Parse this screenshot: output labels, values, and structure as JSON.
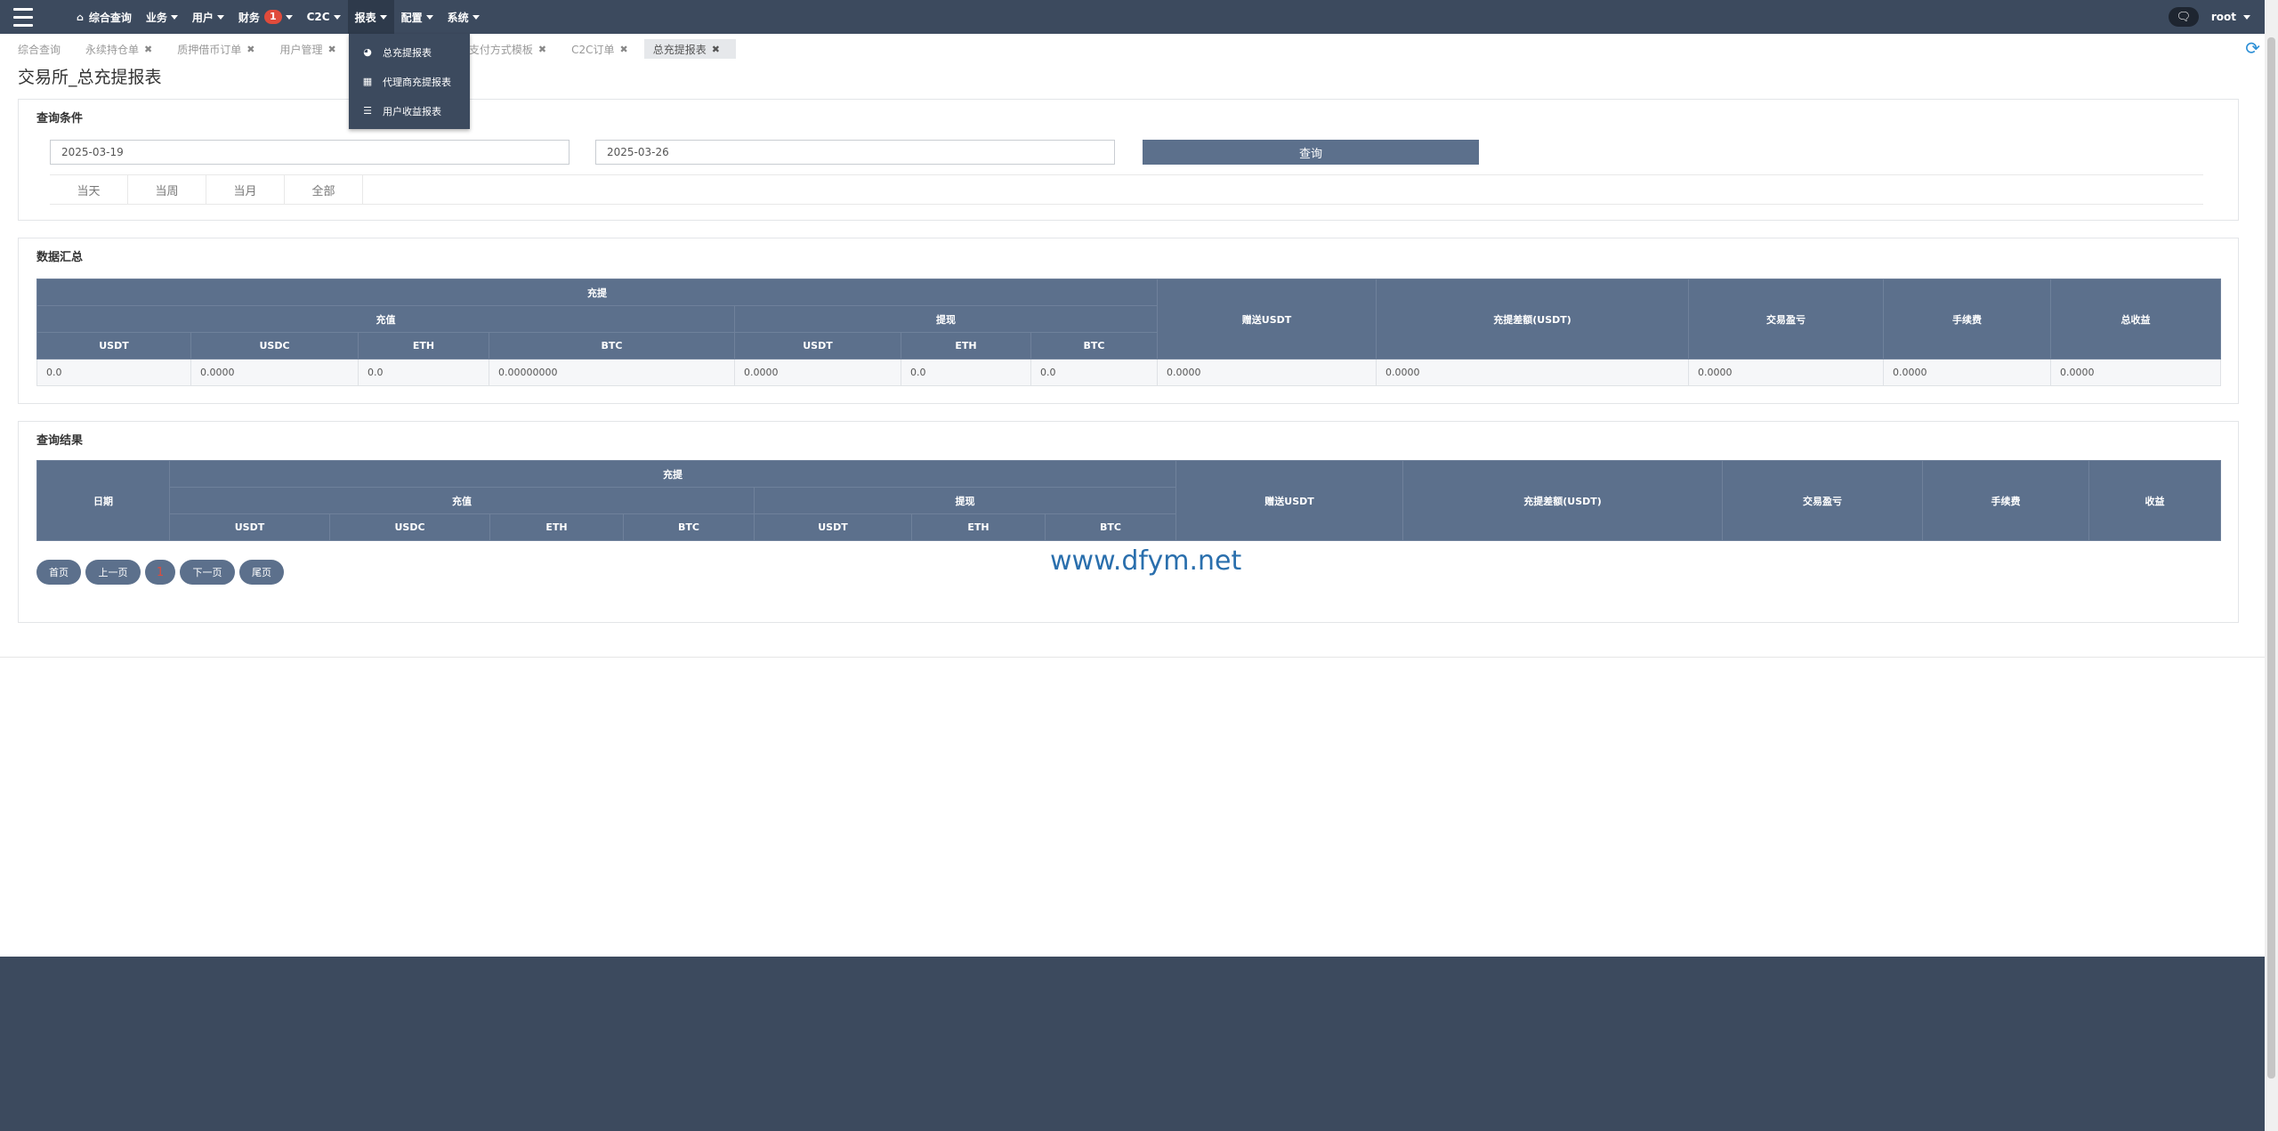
{
  "nav": {
    "home": "综合查询",
    "items": [
      {
        "label": "业务"
      },
      {
        "label": "用户"
      },
      {
        "label": "财务",
        "badge": "1"
      },
      {
        "label": "C2C"
      },
      {
        "label": "报表"
      },
      {
        "label": "配置"
      },
      {
        "label": "系统"
      }
    ],
    "user": "root"
  },
  "dropdown": [
    {
      "label": "总充提报表",
      "icon": "pie-chart-icon"
    },
    {
      "label": "代理商充提报表",
      "icon": "sitemap-icon"
    },
    {
      "label": "用户收益报表",
      "icon": "list-icon"
    }
  ],
  "tabs": [
    {
      "label": "综合查询",
      "closable": false
    },
    {
      "label": "永续持仓单",
      "closable": true
    },
    {
      "label": "质押借币订单",
      "closable": true
    },
    {
      "label": "用户管理",
      "closable": true
    },
    {
      "label": "C2C支付方式模板",
      "closable": true
    },
    {
      "label": "C2C订单",
      "closable": true
    },
    {
      "label": "总充提报表",
      "closable": true,
      "active": true
    }
  ],
  "page_title": "交易所_总充提报表",
  "query": {
    "title": "查询条件",
    "start_date": "2025-03-19",
    "end_date": "2025-03-26",
    "button": "查询",
    "quick": [
      "当天",
      "当周",
      "当月",
      "全部"
    ]
  },
  "summary": {
    "title": "数据汇总",
    "header_top": "充提",
    "group_recharge": "充值",
    "group_withdraw": "提现",
    "col_gift": "赠送USDT",
    "col_diff": "充提差额(USDT)",
    "col_profit": "交易盈亏",
    "col_fee": "手续费",
    "col_total": "总收益",
    "sub_recharge": [
      "USDT",
      "USDC",
      "ETH",
      "BTC"
    ],
    "sub_withdraw": [
      "USDT",
      "ETH",
      "BTC"
    ],
    "row": [
      "0.0",
      "0.0000",
      "0.0",
      "0.00000000",
      "0.0000",
      "0.0",
      "0.0",
      "0.0000",
      "0.0000",
      "0.0000",
      "0.0000",
      "0.0000"
    ]
  },
  "results": {
    "title": "查询结果",
    "col_date": "日期",
    "header_top": "充提",
    "group_recharge": "充值",
    "group_withdraw": "提现",
    "col_gift": "赠送USDT",
    "col_diff": "充提差额(USDT)",
    "col_profit": "交易盈亏",
    "col_fee": "手续费",
    "col_income": "收益",
    "sub_recharge": [
      "USDT",
      "USDC",
      "ETH",
      "BTC"
    ],
    "sub_withdraw": [
      "USDT",
      "ETH",
      "BTC"
    ]
  },
  "pager": {
    "first": "首页",
    "prev": "上一页",
    "current": "1",
    "next": "下一页",
    "last": "尾页"
  },
  "watermark": "www.dfym.net",
  "colors": {
    "nav_bg": "#3c4a5e",
    "header_bg": "#5c708c",
    "badge": "#e04b3b",
    "refresh": "#2c8fd6"
  }
}
